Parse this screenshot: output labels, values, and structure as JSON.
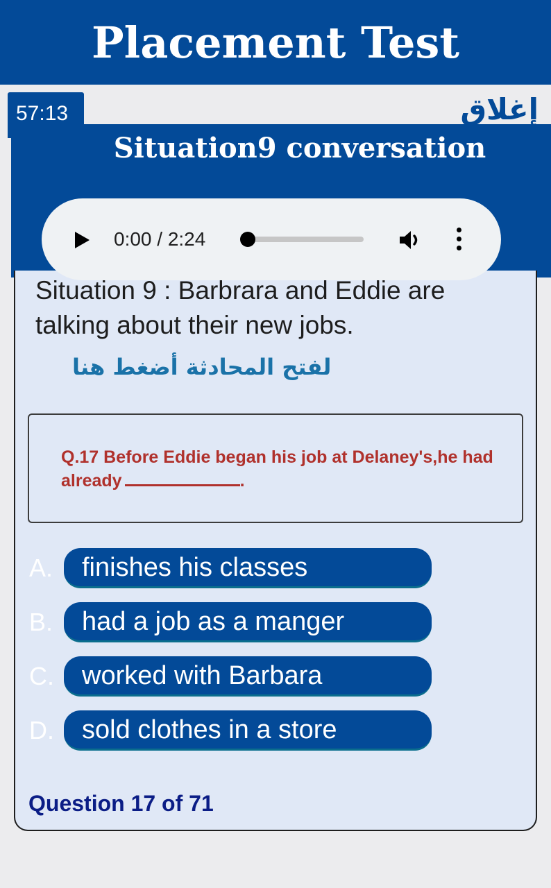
{
  "header": {
    "title": "Placement Test",
    "background_color": "#034a98"
  },
  "timer": {
    "value": "57:13"
  },
  "close_link": {
    "label": "إغلاق"
  },
  "situation": {
    "title": "Situation9 conversation",
    "description": "Situation 9 : Barbrara and Eddie are talking about their new jobs.",
    "open_link": "لفتح المحادثة أضغط هنا"
  },
  "audio": {
    "current_time": "0:00",
    "duration": "2:24",
    "time_display": "0:00 / 2:24",
    "progress_fraction": 0,
    "play_icon": "play-icon",
    "volume_icon": "volume-icon",
    "menu_icon": "more-vert-icon"
  },
  "question": {
    "text": "Q.17 Before Eddie began his job at Delaney's,he had already",
    "trailing": ".",
    "text_color": "#b0312c"
  },
  "answers": [
    {
      "letter": "A.",
      "text": "finishes his classes"
    },
    {
      "letter": "B.",
      "text": "had a job as a manger"
    },
    {
      "letter": "C.",
      "text": "worked with Barbara"
    },
    {
      "letter": "D.",
      "text": "sold clothes in a store"
    }
  ],
  "counter": {
    "text": "Question 17 of 71",
    "color": "#0b1d86"
  }
}
